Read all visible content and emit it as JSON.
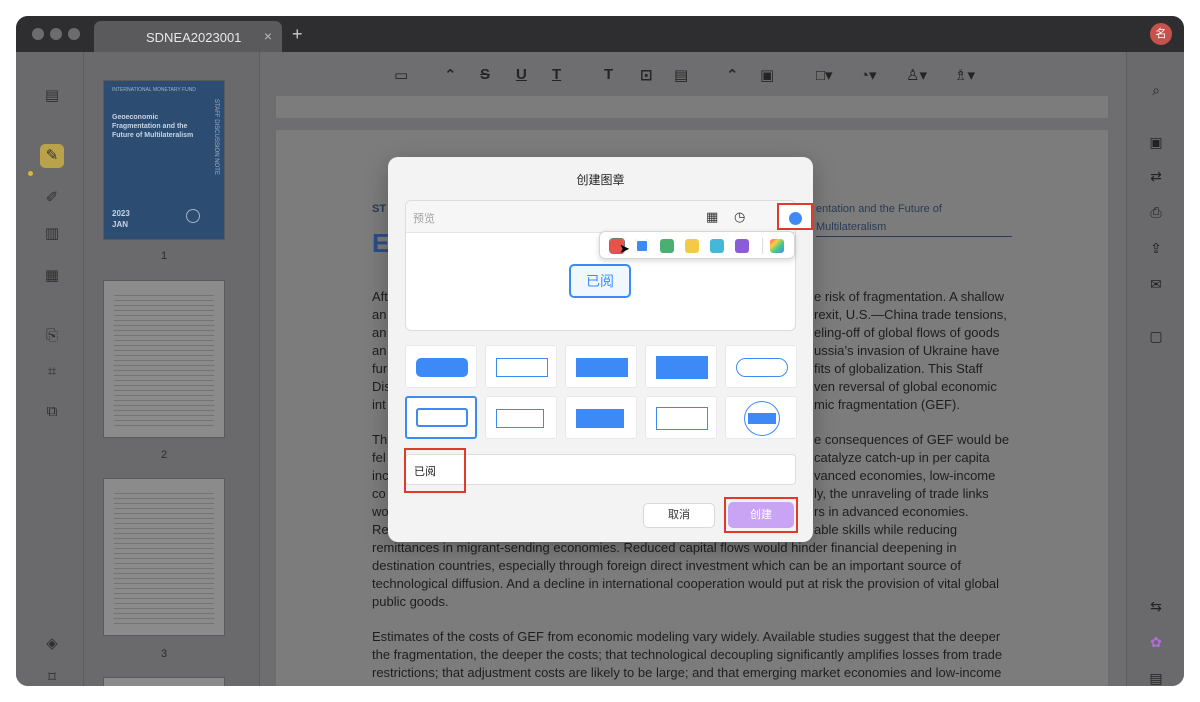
{
  "window": {
    "tab_title": "SDNEA2023001",
    "tab_close": "×",
    "new_tab": "+",
    "profile_initial": "名"
  },
  "thumbnails": {
    "cover_org": "INTERNATIONAL MONETARY FUND",
    "cover_title": "Geoeconomic Fragmentation and the Future of Multilateralism",
    "cover_side": "STAFF DISCUSSION NOTE",
    "cover_year": "2023",
    "cover_month": "JAN",
    "pages": [
      "1",
      "2",
      "3"
    ]
  },
  "document": {
    "header_left": "ST",
    "header_right": "entation and the Future of Multilateralism",
    "heading_letter": "E",
    "p1": [
      "Aft",
      "an",
      "an",
      "an",
      "fur",
      "Dis",
      "int"
    ],
    "p1_right": [
      "e risk of fragmentation. A shallow",
      "rexit, U.S.—China trade tensions,",
      "eling-off of global flows of goods",
      "ussia’s invasion of Ukraine have",
      "fits of globalization. This Staff",
      "ven reversal of global economic",
      "mic fragmentation (GEF)."
    ],
    "p2_left": [
      "Th",
      "fel",
      "inc",
      "co",
      "wo",
      "Re"
    ],
    "p2_right": [
      "e consequences of GEF would be",
      "catalyze catch-up in per capita",
      "vanced economies, low-income",
      "ly, the unraveling of trade links",
      "rs in advanced economies.",
      "able skills while reducing"
    ],
    "p2_lines": [
      "remittances in migrant-sending economies. Reduced capital flows would hinder financial deepening in",
      "destination countries, especially through foreign direct investment which can be an important source of",
      "technological diffusion. And a decline in international cooperation would put at risk the provision of vital global",
      "public goods."
    ],
    "p3_lines": [
      "Estimates of the costs of GEF from economic modeling vary widely. Available studies suggest that the deeper",
      "the fragmentation, the deeper the costs; that technological decoupling significantly amplifies losses from trade",
      "restrictions; that adjustment costs are likely to be large; and that emerging market economies and low-income"
    ]
  },
  "dialog": {
    "title": "创建图章",
    "preview_placeholder": "预览",
    "stamp_text": "已阅",
    "input_value": "已阅",
    "cancel_label": "取消",
    "create_label": "创建",
    "selected_color": "#3d8af7",
    "palette": [
      "#e5534b",
      "#3d8af7",
      "#4caf72",
      "#f4c84a",
      "#45b8d8",
      "#8a5cd8"
    ],
    "stamp_styles": 10,
    "selected_style_index": 5
  }
}
